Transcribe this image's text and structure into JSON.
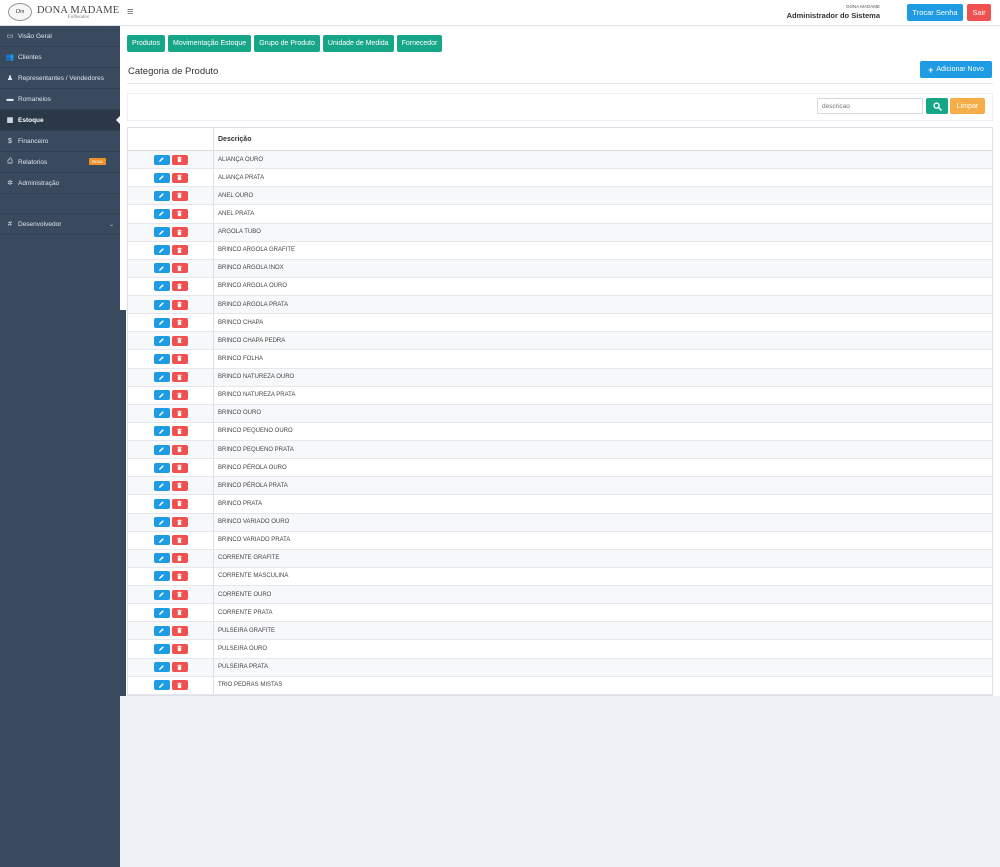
{
  "header": {
    "logo_title": "DONA MADAME",
    "logo_subtitle": "Folheados",
    "logo_mark": "Dm",
    "menu_icon": "≡",
    "company": "DONA MADAME",
    "user_name": "Administrador do Sistema",
    "change_password_label": "Trocar Senha",
    "logout_label": "Sair"
  },
  "sidebar": {
    "items": [
      {
        "label": "Visão Geral",
        "icon": "monitor-icon",
        "glyph": "▭"
      },
      {
        "label": "Clientes",
        "icon": "users-icon",
        "glyph": "👥"
      },
      {
        "label": "Representantes / Vendedores",
        "icon": "user-tie-icon",
        "glyph": "♟"
      },
      {
        "label": "Romaneios",
        "icon": "briefcase-icon",
        "glyph": "▬"
      },
      {
        "label": "Estoque",
        "icon": "grid-icon",
        "glyph": "▦"
      },
      {
        "label": "Financeiro",
        "icon": "dollar-icon",
        "glyph": "$"
      },
      {
        "label": "Relatorios",
        "icon": "printer-icon",
        "glyph": "⎙",
        "badge": "Novo"
      },
      {
        "label": "Administração",
        "icon": "gear-icon",
        "glyph": "✲"
      }
    ],
    "dev_item": {
      "label": "Desenvolvedor",
      "icon": "hashtag-icon",
      "glyph": "#",
      "chevron": "⌄"
    }
  },
  "tabs": [
    "Produtos",
    "Movimentação Estoque",
    "Grupo de Produto",
    "Unidade de Medida",
    "Fornecedor"
  ],
  "page": {
    "title": "Categoria de Produto",
    "add_button": "Adicionar Novo"
  },
  "filter": {
    "placeholder": "descricao",
    "clear_label": "Limpar"
  },
  "table": {
    "column_header": "Descrição",
    "rows": [
      "ALIANÇA OURO",
      "ALIANÇA PRATA",
      "ANEL OURO",
      "ANEL PRATA",
      "ARGOLA TUBO",
      "BRINCO ARGOLA GRAFITE",
      "BRINCO ARGOLA INOX",
      "BRINCO ARGOLA OURO",
      "BRINCO ARGOLA PRATA",
      "BRINCO CHAPA",
      "BRINCO CHAPA PEDRA",
      "BRINCO FOLHA",
      "BRINCO NATUREZA OURO",
      "BRINCO NATUREZA PRATA",
      "BRINCO OURO",
      "BRINCO PEQUENO OURO",
      "BRINCO PEQUENO PRATA",
      "BRINCO PÉROLA OURO",
      "BRINCO PÉROLA PRATA",
      "BRINCO PRATA",
      "BRINCO VARIADO OURO",
      "BRINCO VARIADO PRATA",
      "CORRENTE GRAFITE",
      "CORRENTE MASCULINA",
      "CORRENTE OURO",
      "CORRENTE PRATA",
      "PULSEIRA GRAFITE",
      "PULSEIRA OURO",
      "PULSEIRA PRATA",
      "TRIO PEDRAS MISTAS"
    ]
  },
  "colors": {
    "primary": "#1e9be3",
    "success": "#18a689",
    "danger": "#f05050",
    "warning": "#f5ad47",
    "sidebar": "#3a4a5e"
  }
}
